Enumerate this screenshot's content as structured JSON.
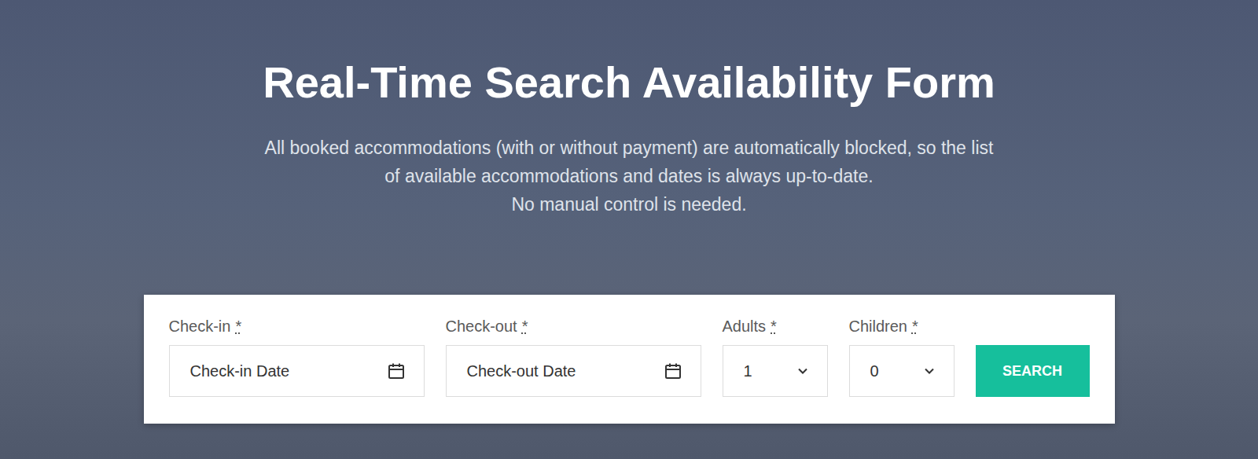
{
  "heading": {
    "title": "Real-Time Search Availability Form",
    "description": [
      "All booked accommodations (with or without payment) are automatically blocked, so the list",
      "of available accommodations and dates is always up-to-date.",
      "No manual control is needed."
    ]
  },
  "form": {
    "fields": [
      {
        "label": "Check-in",
        "required": "*",
        "kind": "date",
        "value": "Check-in Date"
      },
      {
        "label": "Check-out",
        "required": "*",
        "kind": "date",
        "value": "Check-out Date"
      },
      {
        "label": "Adults",
        "required": "*",
        "kind": "select",
        "value": "1"
      },
      {
        "label": "Children",
        "required": "*",
        "kind": "select",
        "value": "0"
      }
    ],
    "button": "SEARCH"
  }
}
